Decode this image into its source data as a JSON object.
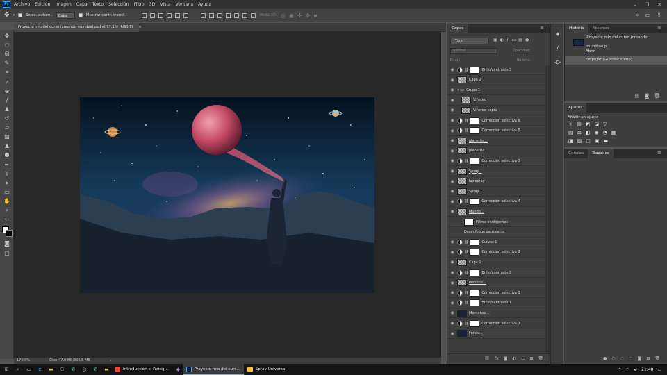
{
  "app": {
    "logo": "Ps",
    "menu": [
      "Archivo",
      "Edición",
      "Imagen",
      "Capa",
      "Texto",
      "Selección",
      "Filtro",
      "3D",
      "Vista",
      "Ventana",
      "Ayuda"
    ]
  },
  "options": {
    "autoselect_label": "Selec. autom.:",
    "autoselect_value": "Capa",
    "transform_label": "Mostrar contr. transf.",
    "mode3d_label": "Modo 3D:"
  },
  "document": {
    "tab_title": "Proyecto mio del curso (creando mundos).psd al 17,1% (RGB/8)",
    "tab_close": "×"
  },
  "status": {
    "zoom": "17,08%",
    "doc": "Doc: 47,0 MB/305,6 MB"
  },
  "layers_panel": {
    "tab": "Capas",
    "filter": "Tipo",
    "blend": "Normal",
    "opacity_label": "Opacidad:",
    "lock_label": "Bloq.:",
    "fill_label": "Relleno:",
    "layers": [
      {
        "name": "Brillo/contraste 3",
        "thumb": "adj"
      },
      {
        "name": "Capa 2",
        "thumb": "chk"
      },
      {
        "name": "Grupo 1",
        "thumb": "folder"
      },
      {
        "name": "Viñeteo",
        "thumb": "chk"
      },
      {
        "name": "Viñeteo copia",
        "thumb": "chk"
      },
      {
        "name": "Corrección selectiva 6",
        "thumb": "adj"
      },
      {
        "name": "Corrección selectiva 5",
        "thumb": "adj"
      },
      {
        "name": "planetita...",
        "thumb": "chk"
      },
      {
        "name": "planetita",
        "thumb": "chk"
      },
      {
        "name": "Corrección selectiva 3",
        "thumb": "adj"
      },
      {
        "name": "Spray...",
        "thumb": "chk"
      },
      {
        "name": "luz spray",
        "thumb": "chk"
      },
      {
        "name": "Spray 1",
        "thumb": "chk"
      },
      {
        "name": "Corrección selectiva 4",
        "thumb": "adj"
      },
      {
        "name": "Mundo...",
        "thumb": "chk"
      },
      {
        "name": "Filtros inteligentes",
        "thumb": "white"
      },
      {
        "name": "Desenfoque gaussiano",
        "thumb": "none"
      },
      {
        "name": "Curvas 1",
        "thumb": "adj"
      },
      {
        "name": "Corrección selectiva 2",
        "thumb": "adj"
      },
      {
        "name": "Capa 1",
        "thumb": "chk"
      },
      {
        "name": "Brillo/contraste 2",
        "thumb": "adj"
      },
      {
        "name": "Persona...",
        "thumb": "chk"
      },
      {
        "name": "Corrección selectiva 1",
        "thumb": "adj"
      },
      {
        "name": "Brillo/contraste 1",
        "thumb": "adj"
      },
      {
        "name": "Montañas...",
        "thumb": "dark"
      },
      {
        "name": "Corrección selectiva 7",
        "thumb": "adj"
      },
      {
        "name": "Fondo...",
        "thumb": "dark"
      }
    ]
  },
  "history_panel": {
    "tabs": [
      "Historia",
      "Acciones"
    ],
    "snapshot": "Proyecto mio del curso (creando mundos).p...",
    "items": [
      "Abrir",
      "Empujar (Guardar como)"
    ]
  },
  "adjustments_panel": {
    "tab": "Ajustes",
    "hint": "Añadir un ajuste"
  },
  "paths_panel": {
    "tabs": [
      "Canales",
      "Trazados"
    ]
  },
  "taskbar": {
    "apps": [
      "Introducción al Retoq...",
      "Proyecto mio del curs...",
      "Spray Universo"
    ],
    "time": "21:48"
  }
}
